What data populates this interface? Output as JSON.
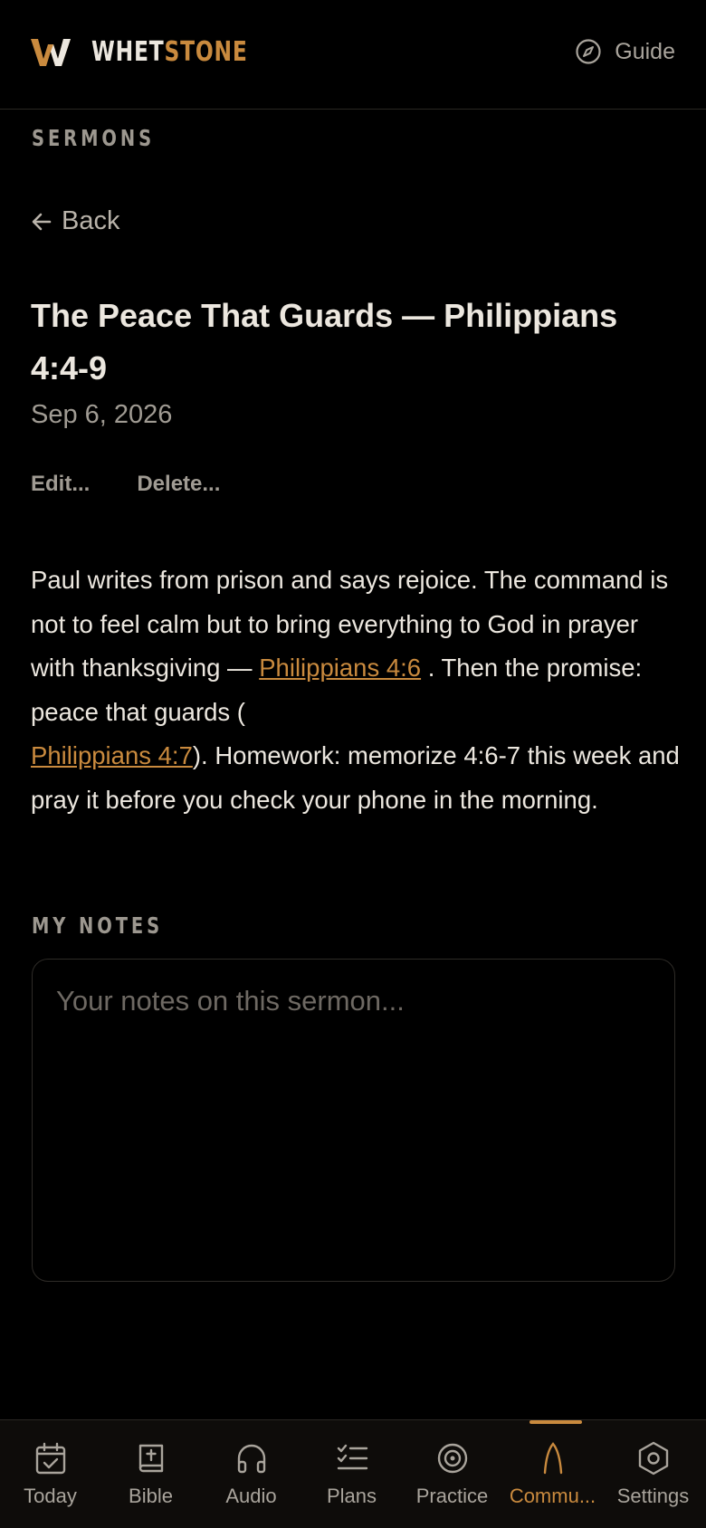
{
  "app": {
    "brand_part1": "WHET",
    "brand_part2": "STONE",
    "guide_label": "Guide"
  },
  "section": {
    "label": "SERMONS"
  },
  "back_label": "Back",
  "sermon": {
    "title": "The Peace That Guards — Philippians 4:4-9",
    "date": "Sep 6, 2026",
    "edit_label": "Edit...",
    "delete_label": "Delete...",
    "body_part1": "Paul writes from prison and says rejoice. The command is not to feel calm but to bring everything to God in prayer with thanksgiving — ",
    "ref1": "Philippians 4:6",
    "body_part2": " . Then the promise: peace that guards ( ",
    "ref2": "Philippians 4:7",
    "body_part3": "). Homework: memorize 4:6-7 this week and pray it before you check your phone in the morning."
  },
  "notes": {
    "label": "MY NOTES",
    "placeholder": "Your notes on this sermon..."
  },
  "tabs": [
    {
      "label": "Today",
      "icon": "calendar-check-icon"
    },
    {
      "label": "Bible",
      "icon": "bible-icon"
    },
    {
      "label": "Audio",
      "icon": "headphones-icon"
    },
    {
      "label": "Plans",
      "icon": "checklist-icon"
    },
    {
      "label": "Practice",
      "icon": "target-icon"
    },
    {
      "label": "Commu...",
      "icon": "arch-icon",
      "active": true
    },
    {
      "label": "Settings",
      "icon": "hexagon-settings-icon"
    }
  ],
  "colors": {
    "accent": "#c98a3e",
    "background": "#000000",
    "text": "#ece7df",
    "muted": "#a09b93"
  }
}
